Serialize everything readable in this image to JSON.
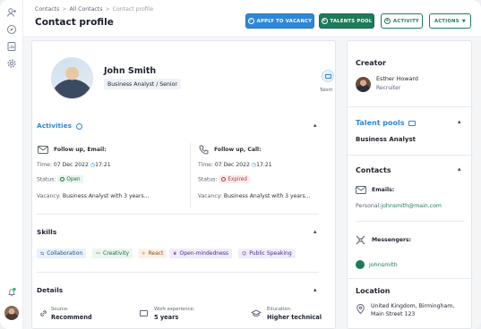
{
  "breadcrumb": {
    "items": [
      "Contacts",
      "All Contacts",
      "Contact profile"
    ]
  },
  "page": {
    "title": "Contact profile"
  },
  "actions": {
    "apply_vacancy": "APPLY TO VACANCY",
    "talents_pool": "TALENTS POOL",
    "activity": "ACTIVITY",
    "actions": "ACTIONS"
  },
  "profile": {
    "name": "John Smith",
    "role": "Business Analyst / Senior",
    "talent_label": "Talent"
  },
  "activities": {
    "title": "Activities",
    "items": [
      {
        "type": "Follow up, Email:",
        "time_label": "Time:",
        "date": "07 Dec 2022",
        "time": "17:21",
        "status_label": "Status:",
        "status": "Open",
        "vacancy_label": "Vacancy:",
        "vacancy": "Business Analyst with 3 years..."
      },
      {
        "type": "Follow up, Call:",
        "time_label": "Time:",
        "date": "07 Dec 2022",
        "time": "17:21",
        "status_label": "Status:",
        "status": "Expired",
        "vacancy_label": "Vacancy:",
        "vacancy": "Business Analyst with 3 years..."
      }
    ]
  },
  "skills": {
    "title": "Skills",
    "items": [
      "Collaboration",
      "Creativity",
      "React",
      "Open-mindedness",
      "Public Speaking"
    ]
  },
  "details": {
    "title": "Details",
    "source_label": "Source:",
    "source": "Recommend",
    "experience_label": "Work experience:",
    "experience": "5 years",
    "education_label": "Education:",
    "education": "Higher technical"
  },
  "sidebar": {
    "creator_title": "Creator",
    "creator_name": "Esther Howard",
    "creator_role": "Recruiter",
    "talent_pools_title": "Talent pools",
    "talent_pool": "Business Analyst",
    "contacts_title": "Contacts",
    "emails_label": "Emails:",
    "personal_label": "Personal:",
    "personal_email": "johnsmith@main.com",
    "messengers_label": "Messengers:",
    "messenger": "johnsmith",
    "location_title": "Location",
    "location_line1": "United Kingdom, Birmingham,",
    "location_line2": "Main Street 123"
  },
  "colors": {
    "primary": "#2e86d8",
    "green": "#1f7a5a",
    "danger": "#b23a3a"
  }
}
